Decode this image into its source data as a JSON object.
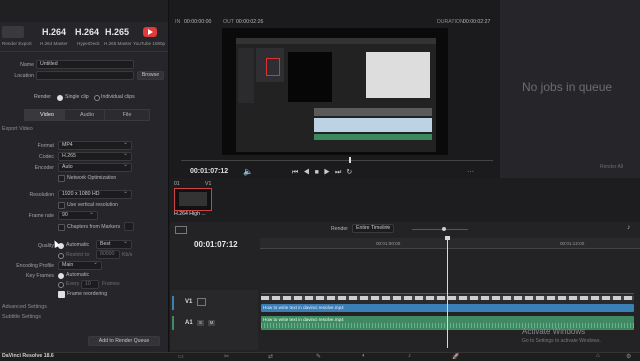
{
  "formats": [
    {
      "name": "",
      "sub": "Render Export"
    },
    {
      "name": "H.264",
      "sub": "H.264 Master"
    },
    {
      "name": "H.264",
      "sub": "HyperDeck"
    },
    {
      "name": "H.265",
      "sub": "H.265 Master"
    },
    {
      "name": "",
      "sub": "YouTube 1080p"
    }
  ],
  "file": {
    "name_label": "Name",
    "name_value": "Untitled",
    "location_label": "Location",
    "location_value": "",
    "browse": "Browse"
  },
  "render": {
    "label": "Render",
    "single": "Single clip",
    "individual": "Individual clips"
  },
  "tabs": [
    "Video",
    "Audio",
    "File"
  ],
  "export_video": "Export Video",
  "video": {
    "format_label": "Format",
    "format": "MP4",
    "codec_label": "Codec",
    "codec": "H.265",
    "encoder_label": "Encoder",
    "encoder": "Auto",
    "network_opt": "Network Optimization",
    "resolution_label": "Resolution",
    "resolution": "1920 x 1080 HD",
    "vertical_res": "Use vertical resolution",
    "frame_rate_label": "Frame rate",
    "frame_rate": "90",
    "chapters": "Chapters from Markers",
    "quality_label": "Quality",
    "automatic": "Automatic",
    "best": "Best",
    "restrict_to": "Restrict to",
    "kbps_value": "80000",
    "kbps": "Kb/s",
    "profile_label": "Encoding Profile",
    "profile": "Main",
    "keyframes_label": "Key Frames",
    "kf_auto": "Automatic",
    "every": "Every",
    "kf_frames": "10",
    "frames": "Frames",
    "frame_reorder": "Frame reordering"
  },
  "advanced": "Advanced Settings",
  "subtitle": "Subtitle Settings",
  "add_queue": "Add to Render Queue",
  "viewer": {
    "in_label": "IN",
    "in_tc": "00:00:00:00",
    "out_label": "OUT",
    "out_tc": "00:00:02:26",
    "dur_label": "DURATION",
    "dur_tc": "00:00:02:27",
    "playhead_tc": "00:01:07:12"
  },
  "queue": {
    "empty": "No jobs in queue",
    "render_all": "Render All"
  },
  "thumb": {
    "index": "01",
    "track": "V1",
    "label": "H.264 High ..."
  },
  "timeline": {
    "tc": "00:01:07:12",
    "render_label": "Render",
    "render_range": "Entire Timeline",
    "ruler": [
      "00:01:00:00",
      "00:01:12:00"
    ],
    "v1": "V1",
    "a1": "A1",
    "video_clip": "How to write text in davinci resolve.mp4",
    "audio_clip": "How to write text in davinci resolve.mp4"
  },
  "watermark": {
    "title": "Activate Windows",
    "sub": "Go to Settings to activate Windows."
  },
  "app_title": "DaVinci Resolve 18.6",
  "colors": {
    "accent": "#e03a3a",
    "audio_clip": "#3f8a63",
    "video_clip": "#3a7fb5"
  }
}
